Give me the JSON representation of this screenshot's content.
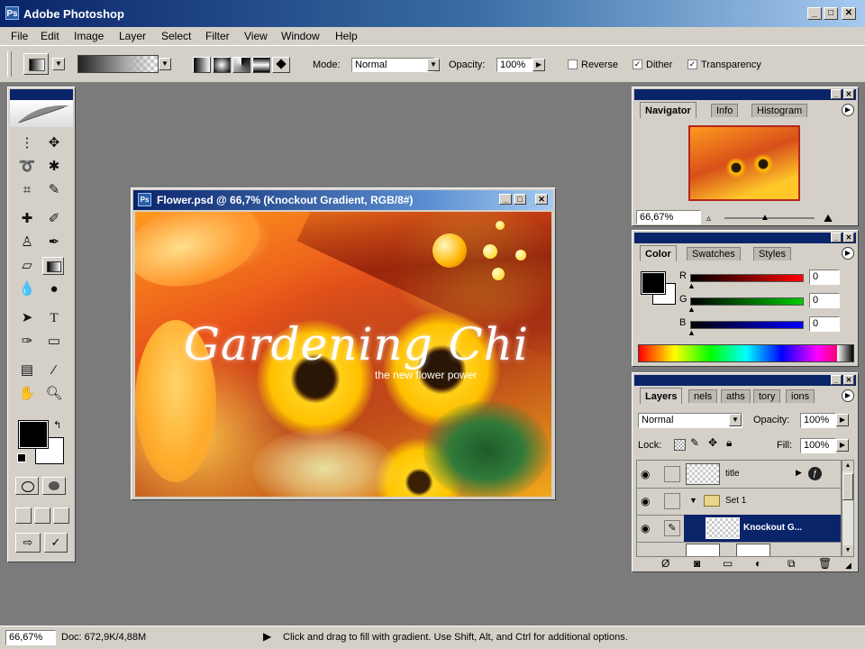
{
  "app": {
    "title": "Adobe Photoshop"
  },
  "menu": [
    "File",
    "Edit",
    "Image",
    "Layer",
    "Select",
    "Filter",
    "View",
    "Window",
    "Help"
  ],
  "options": {
    "mode_label": "Mode:",
    "mode_value": "Normal",
    "opacity_label": "Opacity:",
    "opacity_value": "100%",
    "reverse_label": "Reverse",
    "reverse_checked": false,
    "dither_label": "Dither",
    "dither_checked": true,
    "transparency_label": "Transparency",
    "transparency_checked": true
  },
  "document": {
    "title": "Flower.psd @ 66,7% (Knockout Gradient, RGB/8#)",
    "artwork_title": "Gardening Chi",
    "artwork_subtitle": "the new flower power"
  },
  "navigator": {
    "tabs": [
      "Navigator",
      "Info",
      "Histogram"
    ],
    "zoom": "66,67%"
  },
  "color": {
    "tabs": [
      "Color",
      "Swatches",
      "Styles"
    ],
    "r_label": "R",
    "g_label": "G",
    "b_label": "B",
    "r_value": "0",
    "g_value": "0",
    "b_value": "0"
  },
  "layers": {
    "tabs": [
      "Layers",
      "nels",
      "aths",
      "tory",
      "ions"
    ],
    "blend": "Normal",
    "opacity_label": "Opacity:",
    "opacity_value": "100%",
    "lock_label": "Lock:",
    "fill_label": "Fill:",
    "fill_value": "100%",
    "rows": [
      {
        "name": "title"
      },
      {
        "name": "Set 1"
      },
      {
        "name": "Knockout G..."
      }
    ]
  },
  "status": {
    "zoom": "66,67%",
    "doc": "Doc: 672,9K/4,88M",
    "message": "Click and drag to fill with gradient.  Use Shift, Alt, and Ctrl for additional options."
  },
  "colors": {
    "titlebar": "#0a246a",
    "chrome": "#d4d0c8",
    "workspace": "#7b7b7b",
    "selected_layer": "#0a246a"
  }
}
